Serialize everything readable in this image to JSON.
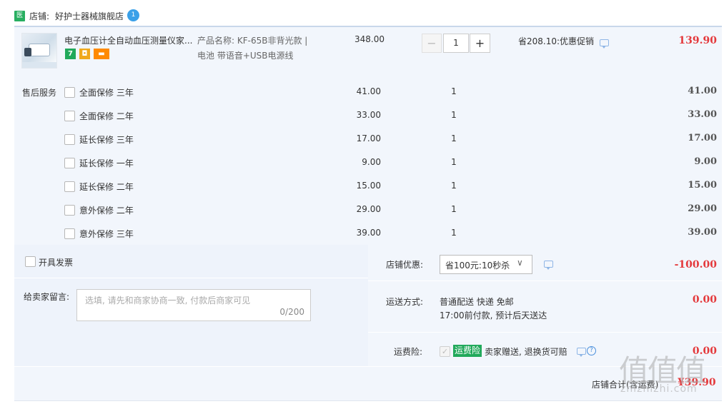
{
  "store": {
    "icon": "shop-icon",
    "icon_char": "医",
    "label": "店铺:",
    "name": "好护士器械旗舰店",
    "wangwang_char": "1"
  },
  "item": {
    "title": "电子血压计全自动血压测量仪家...",
    "badges": [
      "7",
      "◘",
      "▬"
    ],
    "sku_line1": "产品名称: KF-65B非背光款 |",
    "sku_line2": "电池 带语音+USB电源线",
    "price": "348.00",
    "qty_minus": "−",
    "qty_value": "1",
    "qty_plus": "+",
    "promo": "省208.10:优惠促销",
    "subtotal": "139.90"
  },
  "services": {
    "title": "售后服务",
    "rows": [
      {
        "name": "全面保修 三年",
        "price": "41.00",
        "qty": "1",
        "total": "41.00"
      },
      {
        "name": "全面保修 二年",
        "price": "33.00",
        "qty": "1",
        "total": "33.00"
      },
      {
        "name": "延长保修 三年",
        "price": "17.00",
        "qty": "1",
        "total": "17.00"
      },
      {
        "name": "延长保修 一年",
        "price": "9.00",
        "qty": "1",
        "total": "9.00"
      },
      {
        "name": "延长保修 二年",
        "price": "15.00",
        "qty": "1",
        "total": "15.00"
      },
      {
        "name": "意外保修 二年",
        "price": "29.00",
        "qty": "1",
        "total": "29.00"
      },
      {
        "name": "意外保修 三年",
        "price": "39.00",
        "qty": "1",
        "total": "39.00"
      }
    ]
  },
  "invoice": {
    "label": "开具发票"
  },
  "message": {
    "label": "给卖家留言:",
    "placeholder": "选填, 请先和商家协商一致, 付款后商家可见",
    "counter": "0/200"
  },
  "discount": {
    "label": "店铺优惠:",
    "selected": "省100元:10秒杀",
    "amount": "-100.00"
  },
  "shipping": {
    "label": "运送方式:",
    "line1": "普通配送 快递 免邮",
    "line2": "17:00前付款, 预计后天送达",
    "amount": "0.00"
  },
  "insurance": {
    "label": "运费险:",
    "tag": "运费险",
    "text": "卖家赠送, 退换货可赔",
    "help": "?",
    "amount": "0.00"
  },
  "total": {
    "label": "店铺合计(含运费)",
    "amount": "¥39.90"
  },
  "watermark": {
    "chars": "值值值",
    "url": "zhizhizhi.com"
  },
  "colors": {
    "accent_red": "#e4393c",
    "panel_blue": "#f2f6fc",
    "tag_green": "#21a95b"
  }
}
